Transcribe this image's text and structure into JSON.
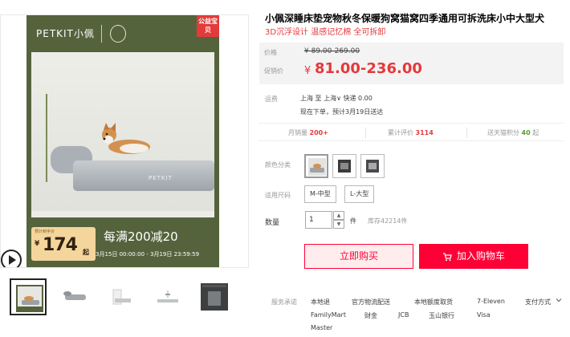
{
  "gallery": {
    "brand": "PETKIT小佩",
    "welfare_badge": "公益宝贝",
    "bed_logo": "PETKIT",
    "price_tag_label": "预计到手价",
    "price_yen": "¥",
    "price_value": "174",
    "price_unit": "起",
    "promo_text": "每满200减20",
    "promo_dates": "3月15日 00:00:00 - 3月19日 23:59:59",
    "thumbnail_count": 5
  },
  "product": {
    "title": "小佩深睡床垫宠物秋冬保暖狗窝猫窝四季通用可拆洗床小中大型犬",
    "subtitle": "3D沉浮设计 温感记忆棉 全可拆卸"
  },
  "price": {
    "original_label": "价格",
    "original_value": "¥ 89.00-269.00",
    "promo_label": "促销价",
    "promo_yen": "¥",
    "promo_value": "81.00-236.00"
  },
  "shipping": {
    "label": "运费",
    "route": "上海 至 上海∨ 快递 0.00",
    "eta": "现在下单，预计3月19日送达"
  },
  "stats": {
    "monthly_label": "月销量",
    "monthly_value": "200+",
    "reviews_label": "累计评价",
    "reviews_value": "3114",
    "points_label": "送天猫积分",
    "points_value": "40",
    "points_unit": "起"
  },
  "options": {
    "color_label": "颜色分类",
    "size_label": "适用尺码",
    "sizes": [
      "M-中型",
      "L-大型"
    ],
    "quantity_label": "数量",
    "quantity_value": "1",
    "quantity_unit": "件",
    "stock": "库存42214件"
  },
  "actions": {
    "buy_now": "立即购买",
    "add_cart": "加入购物车"
  },
  "services": {
    "label": "服务承诺",
    "items": [
      "本地退",
      "官方物流配送",
      "本地额度取货",
      "7-Eleven",
      "FamilyMart",
      "财金",
      "JCB",
      "玉山银行",
      "Visa",
      "Master"
    ],
    "payment_label": "支付方式"
  },
  "colors": {
    "accent_red": "#e4393c",
    "buy_red": "#ff0036",
    "frame_green": "#55633d"
  }
}
